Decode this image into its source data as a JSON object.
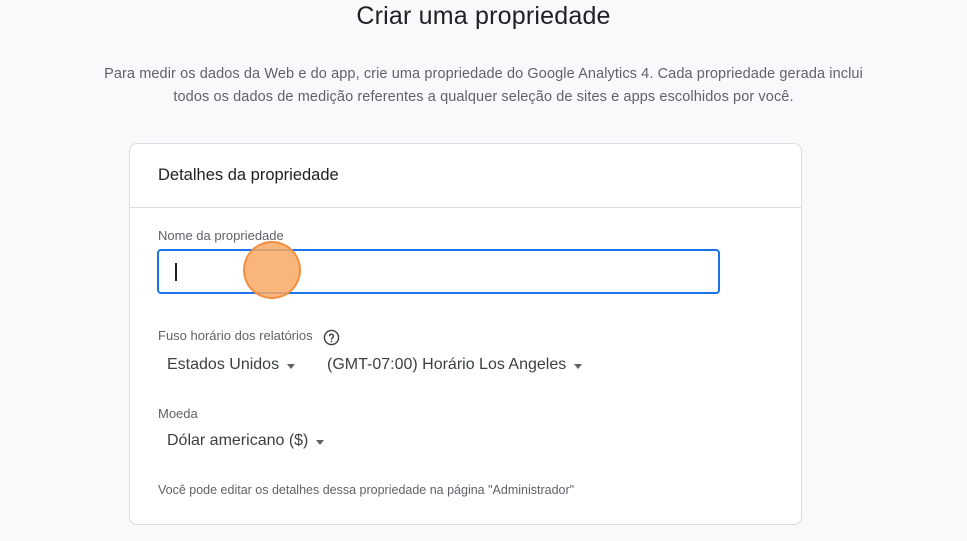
{
  "page": {
    "title": "Criar uma propriedade",
    "intro_line1": "Para medir os dados da Web e do app, crie uma propriedade do Google Analytics 4. Cada propriedade gerada inclui",
    "intro_line2": "todos os dados de medição referentes a qualquer seleção de sites e apps escolhidos por você."
  },
  "card": {
    "header": "Detalhes da propriedade",
    "property_name": {
      "label": "Nome da propriedade",
      "value": ""
    },
    "timezone": {
      "label": "Fuso horário dos relatórios",
      "help_icon": "help-circle-icon",
      "country": "Estados Unidos",
      "zone": "(GMT-07:00) Horário Los Angeles"
    },
    "currency": {
      "label": "Moeda",
      "value": "Dólar americano ($)"
    },
    "footnote": "Você pode editar os detalhes dessa propriedade na página \"Administrador\""
  },
  "colors": {
    "accent": "#1a73e8",
    "click_marker": "#f9a864"
  }
}
